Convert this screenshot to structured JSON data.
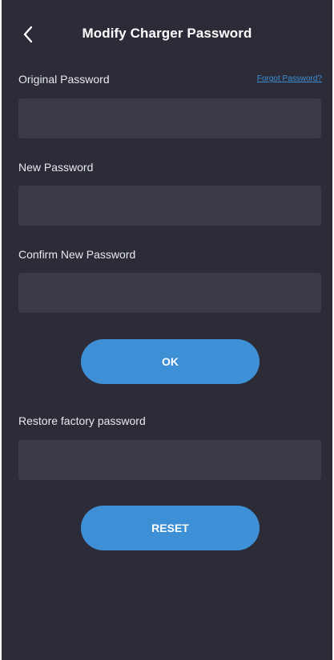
{
  "header": {
    "back_icon": "chevron-left-icon",
    "title": "Modify Charger Password"
  },
  "original_password": {
    "label": "Original Password",
    "value": "",
    "forgot_link": "Forgot Password?"
  },
  "new_password": {
    "label": "New Password",
    "value": ""
  },
  "confirm_password": {
    "label": "Confirm New Password",
    "value": ""
  },
  "ok_button": {
    "label": "OK"
  },
  "restore": {
    "label": "Restore factory password",
    "value": ""
  },
  "reset_button": {
    "label": "RESET"
  },
  "colors": {
    "background": "#2b2c37",
    "input_background": "#3a3b47",
    "accent": "#3d8fd6",
    "text": "#ffffff"
  }
}
